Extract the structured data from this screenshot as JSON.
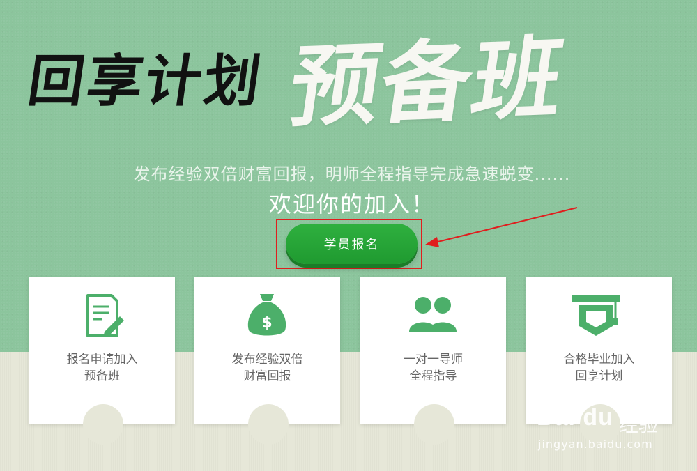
{
  "hero": {
    "title_black": "回享计划",
    "title_white": "预备班",
    "subtitle": "发布经验双倍财富回报，明师全程指导完成急速蜕变......",
    "welcome": "欢迎你的加入！",
    "cta_label": "学员报名"
  },
  "cards": [
    {
      "icon": "application-form-icon",
      "line1": "报名申请加入",
      "line2": "预备班"
    },
    {
      "icon": "money-bag-icon",
      "line1": "发布经验双倍",
      "line2": "财富回报"
    },
    {
      "icon": "mentor-people-icon",
      "line1": "一对一导师",
      "line2": "全程指导"
    },
    {
      "icon": "graduation-cap-icon",
      "line1": "合格毕业加入",
      "line2": "回享计划"
    }
  ],
  "watermark": {
    "logo": "Bai du",
    "text": "经验",
    "url": "jingyan.baidu.com"
  },
  "colors": {
    "hero_bg": "#8cc59d",
    "accent_green": "#4caf6a",
    "button_green": "#2aa83a",
    "highlight_red": "#e01e1e"
  }
}
